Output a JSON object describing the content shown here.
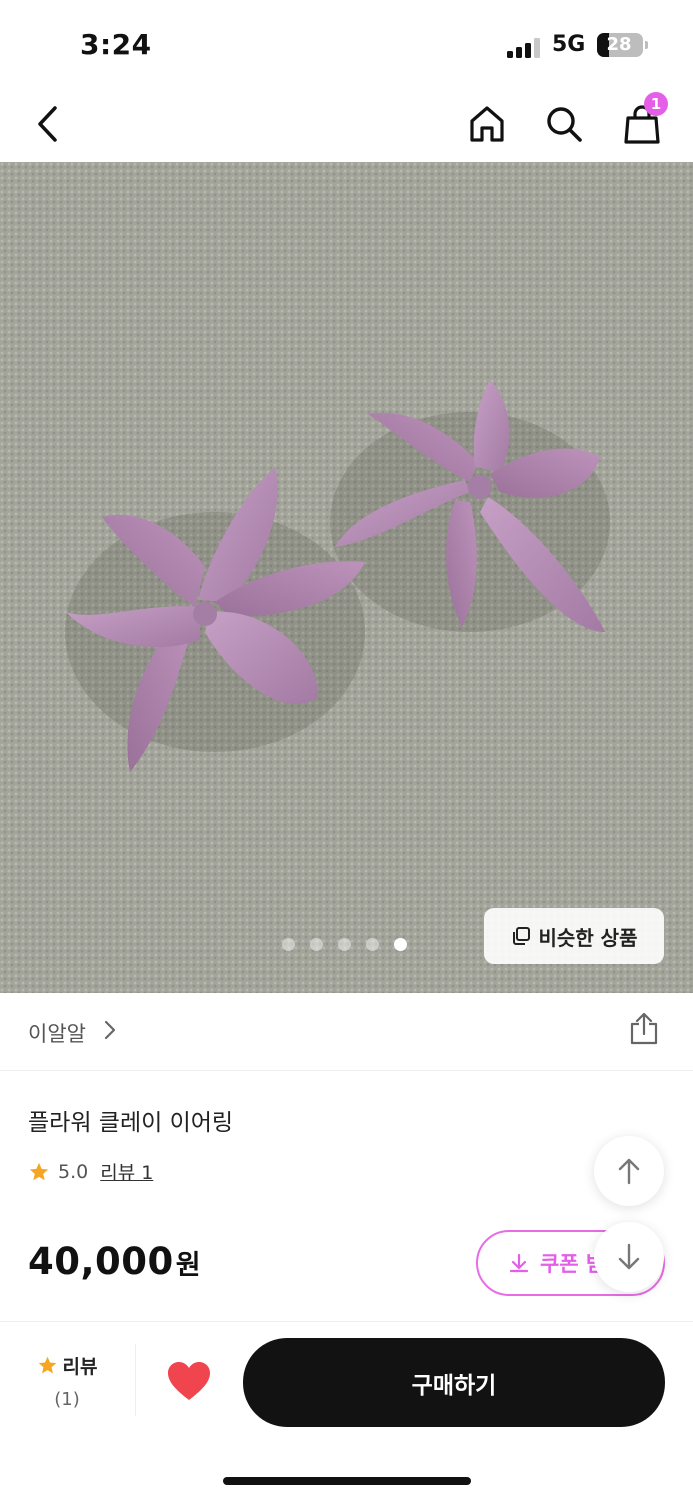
{
  "status_bar": {
    "time": "3:24",
    "network": "5G",
    "battery": "28",
    "battery_level": 0.28
  },
  "nav": {
    "back_icon": "chevron-left-icon",
    "home_icon": "home-icon",
    "search_icon": "search-icon",
    "cart_icon": "shopping-bag-icon",
    "cart_count": "1"
  },
  "gallery": {
    "image_count": 5,
    "active_index": 4,
    "similar_label": "비슷한 상품",
    "similar_icon": "copy-icon"
  },
  "seller": {
    "name": "이알알",
    "share_icon": "share-icon"
  },
  "product": {
    "title": "플라워 클레이 이어링",
    "rating": "5.0",
    "review_label": "리뷰 1",
    "price": "40,000",
    "currency": "원",
    "coupon_label": "쿠폰 받",
    "coupon_icon": "download-icon"
  },
  "float_buttons": {
    "up_icon": "arrow-up-icon",
    "down_icon": "arrow-down-icon"
  },
  "bottom_bar": {
    "review_label": "리뷰",
    "review_count": "(1)",
    "like_icon": "heart-icon",
    "buy_label": "구매하기"
  },
  "colors": {
    "accent": "#e55ee8",
    "star": "#f5a623",
    "heart": "#f0444e",
    "buy_button": "#121212"
  }
}
